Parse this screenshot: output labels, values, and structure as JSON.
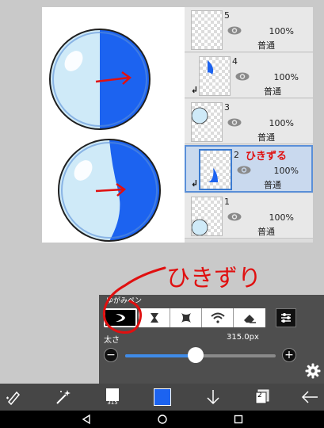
{
  "colors": {
    "accent_blue": "#1c63f0",
    "light_fill": "#cfeaf8",
    "annotation_red": "#e01010",
    "panel_bg": "#4e4e4e",
    "toolbar_bg": "#464646"
  },
  "layers": [
    {
      "number": "5",
      "opacity": "100%",
      "blend": "普通",
      "clipping": false,
      "selected": false
    },
    {
      "number": "4",
      "opacity": "100%",
      "blend": "普通",
      "clipping": true,
      "selected": false
    },
    {
      "number": "3",
      "opacity": "100%",
      "blend": "普通",
      "clipping": false,
      "selected": false
    },
    {
      "number": "2",
      "opacity": "100%",
      "blend": "普通",
      "clipping": true,
      "selected": true
    },
    {
      "number": "1",
      "opacity": "100%",
      "blend": "普通",
      "clipping": false,
      "selected": false
    }
  ],
  "annotations": {
    "layer2_note": "ひきずる",
    "main_note": "ひきずり"
  },
  "brush_panel": {
    "title": "ゆがみペン",
    "tools": [
      "crescent-drag-icon",
      "pinch-icon",
      "bloat-icon",
      "wifi-swirl-icon",
      "eraser-icon"
    ],
    "active_tool_index": 0,
    "size_label": "太さ",
    "size_value": "315.0px",
    "size_fraction": 0.47
  },
  "bottom_toolbar": {
    "items": [
      "pen-cursor-icon",
      "magic-wand-icon",
      "brush-size-icon",
      "color-swatch",
      "download-arrow-icon",
      "layers-icon",
      "back-arrow-icon"
    ],
    "brush_size": "315",
    "current_color": "#1c63f0",
    "layer_count": "2"
  },
  "nav": {
    "items": [
      "back-triangle-icon",
      "home-circle-icon",
      "recents-square-icon"
    ]
  }
}
